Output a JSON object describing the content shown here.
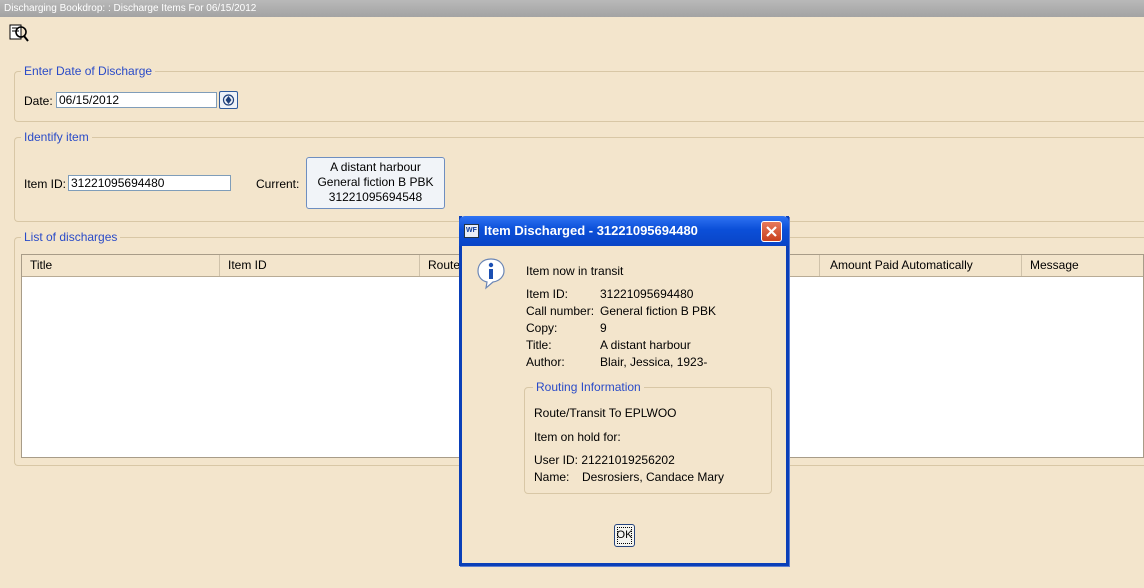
{
  "window": {
    "title": "Discharging Bookdrop: : Discharge Items For 06/15/2012"
  },
  "date_section": {
    "legend": "Enter Date of Discharge",
    "label": "Date:",
    "value": "06/15/2012"
  },
  "item_section": {
    "legend": "Identify item",
    "label": "Item ID:",
    "value": "31221095694480",
    "current_label": "Current:",
    "current_lines": [
      "A distant harbour",
      "General fiction B PBK",
      "31221095694548"
    ]
  },
  "list_section": {
    "legend": "List of discharges",
    "columns": [
      "Title",
      "Item ID",
      "Route",
      "Amount Paid Automatically",
      "Message"
    ]
  },
  "dialog": {
    "title": "Item Discharged - 31221095694480",
    "headline": "Item now in transit",
    "fields": [
      {
        "label": "Item ID:",
        "value": "31221095694480"
      },
      {
        "label": "Call number:",
        "value": "General fiction B PBK"
      },
      {
        "label": "Copy:",
        "value": "9"
      },
      {
        "label": "Title:",
        "value": "A distant harbour"
      },
      {
        "label": "Author:",
        "value": "Blair, Jessica, 1923-"
      }
    ],
    "routing": {
      "legend": "Routing Information",
      "route": "Route/Transit To EPLWOO",
      "hold_label": "Item on hold for:",
      "user_id": "User ID: 21221019256202",
      "name_label": "Name:",
      "name_value": "Desrosiers, Candace Mary"
    },
    "ok_label": "OK"
  },
  "icons": {
    "tool": "magnifier-book-icon",
    "calendar": "calendar-icon",
    "info": "info-icon",
    "close": "close-icon"
  },
  "colors": {
    "legend": "#2a4bc8",
    "titlebar": "#0b4fd8",
    "close": "#c9401e",
    "background": "#f3e5cc"
  }
}
